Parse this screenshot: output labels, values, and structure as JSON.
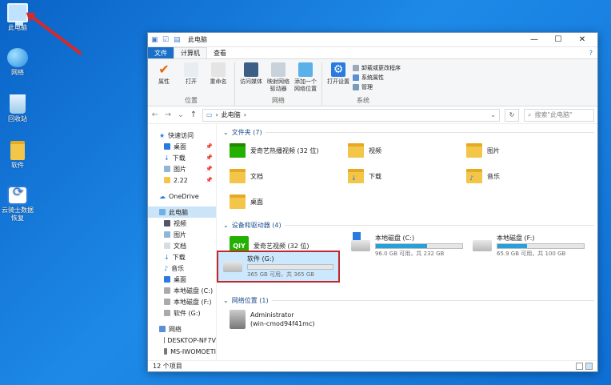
{
  "desktop": {
    "icons": [
      {
        "label": "此电脑"
      },
      {
        "label": "网络"
      },
      {
        "label": "回收站"
      },
      {
        "label": "软件"
      },
      {
        "label": "云骑士数据恢复"
      }
    ]
  },
  "window": {
    "title": "此电脑",
    "controls": [
      "—",
      "☐",
      "✕"
    ],
    "tabs": {
      "file": "文件",
      "computer": "计算机",
      "view": "查看"
    },
    "help": "?",
    "ribbon": {
      "location": {
        "label": "位置",
        "buttons": [
          "属性",
          "打开",
          "重命名"
        ]
      },
      "network": {
        "label": "网络",
        "buttons": [
          "访问媒体",
          "映射网络驱动器",
          "添加一个网络位置"
        ]
      },
      "system": {
        "label": "系统",
        "open_settings": "打开设置",
        "items": [
          "卸载或更改程序",
          "系统属性",
          "管理"
        ]
      }
    },
    "address": {
      "path": "此电脑",
      "search_placeholder": "搜索\"此电脑\""
    },
    "nav": {
      "quick_access": "快速访问",
      "quick_items": [
        "桌面",
        "下载",
        "图片",
        "2.22"
      ],
      "onedrive": "OneDrive",
      "this_pc": "此电脑",
      "pc_items": [
        "视频",
        "图片",
        "文档",
        "下载",
        "音乐",
        "桌面",
        "本地磁盘 (C:)",
        "本地磁盘 (F:)",
        "软件 (G:)"
      ],
      "network": "网络",
      "network_items": [
        "DESKTOP-NF7V",
        "MS-IWOMOETI"
      ]
    },
    "folders_section": "文件夹 (7)",
    "folders": [
      "爱奇艺热播视频 (32 位)",
      "视频",
      "图片",
      "文档",
      "下载",
      "音乐",
      "桌面"
    ],
    "devices_section": "设备和驱动器 (4)",
    "devices": [
      {
        "name": "爱奇艺视频 (32 位)"
      },
      {
        "name": "本地磁盘 (C:)",
        "free": "96.0 GB 可用，共 232 GB",
        "used_fraction": 0.59
      },
      {
        "name": "本地磁盘 (F:)",
        "free": "65.9 GB 可用，共 100 GB",
        "used_fraction": 0.34
      }
    ],
    "selected_drive": {
      "name": "软件 (G:)",
      "free": "365 GB 可用，共 365 GB",
      "used_fraction": 0.0
    },
    "netloc_section": "网络位置 (1)",
    "netloc": {
      "name": "Administrator",
      "sub": "(win-cmod94f41mc)"
    },
    "status": "12 个项目"
  },
  "colors": {
    "accent": "#1a70c8",
    "highlight": "#c0282c",
    "bar": "#26a0da"
  }
}
